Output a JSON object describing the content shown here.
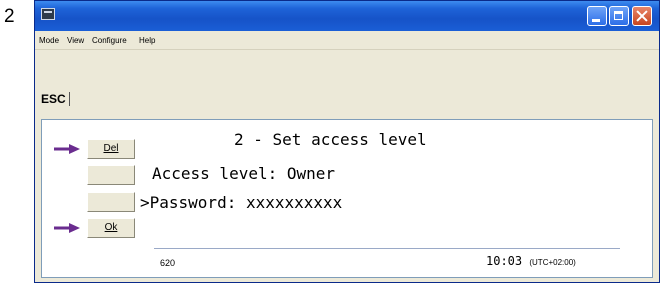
{
  "step_number": "2",
  "menu": {
    "items": [
      "Mode",
      "View",
      "Configure",
      "Help"
    ]
  },
  "toolbar": {
    "esc_label": "ESC"
  },
  "softkeys": {
    "del_label": "Del",
    "blank1_label": "",
    "blank2_label": "",
    "ok_label": "Ok"
  },
  "screen": {
    "title": "2 - Set access level",
    "access_line": "Access level: Owner",
    "password_line": ">Password: xxxxxxxxxx"
  },
  "status": {
    "code": "620",
    "time": "10:03",
    "timezone": "(UTC+02:00)"
  },
  "colors": {
    "arrow": "#6a2c8f",
    "titlebar": "#1e63d8"
  },
  "icons": {
    "app": "app-window-icon",
    "minimize": "minimize-icon",
    "maximize": "maximize-icon",
    "close": "close-icon",
    "arrow": "arrow-right-icon"
  }
}
